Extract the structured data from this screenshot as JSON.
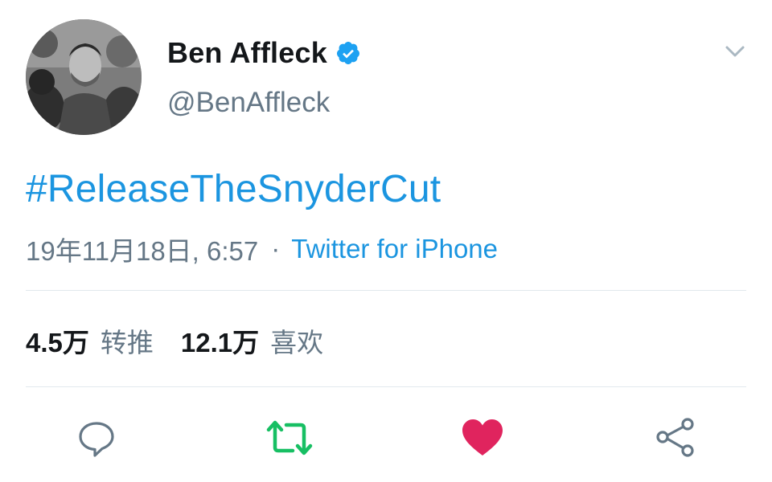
{
  "user": {
    "display_name": "Ben Affleck",
    "handle": "@BenAffleck",
    "verified": true
  },
  "tweet": {
    "text": "#ReleaseTheSnyderCut",
    "timestamp": "19年11月18日, 6:57",
    "separator": "·",
    "source": "Twitter for iPhone"
  },
  "stats": {
    "retweets": {
      "count": "4.5万",
      "label": "转推"
    },
    "likes": {
      "count": "12.1万",
      "label": "喜欢"
    }
  },
  "actions": {
    "reply": "reply-icon",
    "retweet": "retweet-icon",
    "like": "heart-icon",
    "share": "share-icon"
  },
  "colors": {
    "link_blue": "#1b95e0",
    "verified_blue": "#1da1f2",
    "retweet_green": "#17bf63",
    "like_red": "#e0245e",
    "secondary_text": "#657786",
    "divider": "#e1e8ed"
  }
}
